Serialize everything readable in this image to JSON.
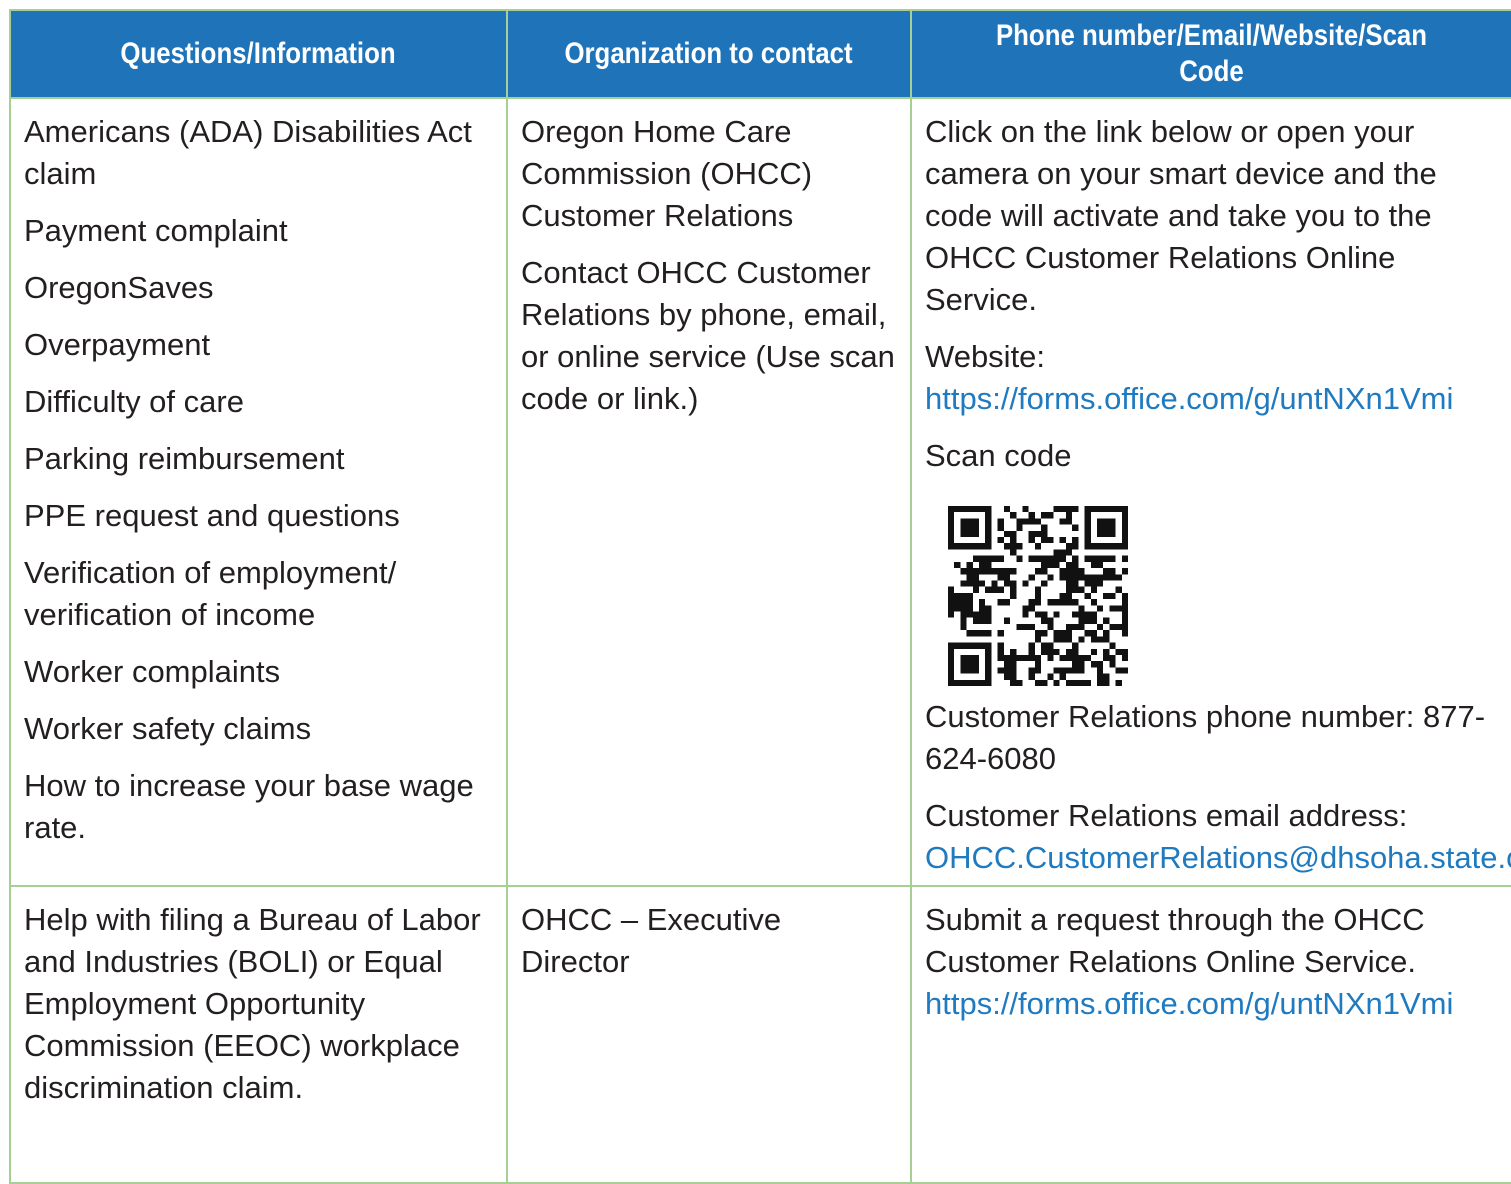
{
  "table": {
    "headers": [
      "Questions/Information",
      "Organization to contact",
      "Phone number/Email/Website/Scan Code"
    ],
    "row1": {
      "questions": [
        "Americans (ADA) Disabilities Act claim",
        "Payment complaint",
        "OregonSaves",
        "Overpayment",
        "Difficulty of care",
        "Parking reimbursement",
        "PPE request and questions",
        "Verification of employment/ verification of income",
        "Worker complaints",
        "Worker safety claims",
        "How to increase your base wage rate."
      ],
      "organization": [
        "Oregon Home Care Commission (OHCC) Customer Relations",
        "Contact OHCC Customer Relations by phone, email, or online service (Use scan code or link.)"
      ],
      "contact": {
        "intro": "Click on the link below or open your camera on your smart device and the code will activate and take you to the OHCC Customer Relations Online Service.",
        "website_label": "Website: ",
        "website_url": "https://forms.office.com/g/untNXn1Vmi",
        "scan_label": "Scan code",
        "qr_icon": "qr-code-icon",
        "phone_text": "Customer Relations phone number: 877-624-6080",
        "email_label": "Customer Relations email address: ",
        "email": "OHCC.CustomerRelations@dhsoha.state.or.us"
      }
    },
    "row2": {
      "question": "Help with filing a Bureau of Labor and Industries (BOLI) or Equal Employment Opportunity Commission (EEOC) workplace discrimination claim.",
      "organization": "OHCC – Executive Director",
      "contact_text": "Submit a request through the OHCC Customer Relations Online Service. ",
      "contact_url": "https://forms.office.com/g/untNXn1Vmi"
    }
  },
  "colors": {
    "header_bg": "#1e73b9",
    "border": "#a5cf94",
    "link": "#1f7ac0",
    "text": "#231f20"
  }
}
